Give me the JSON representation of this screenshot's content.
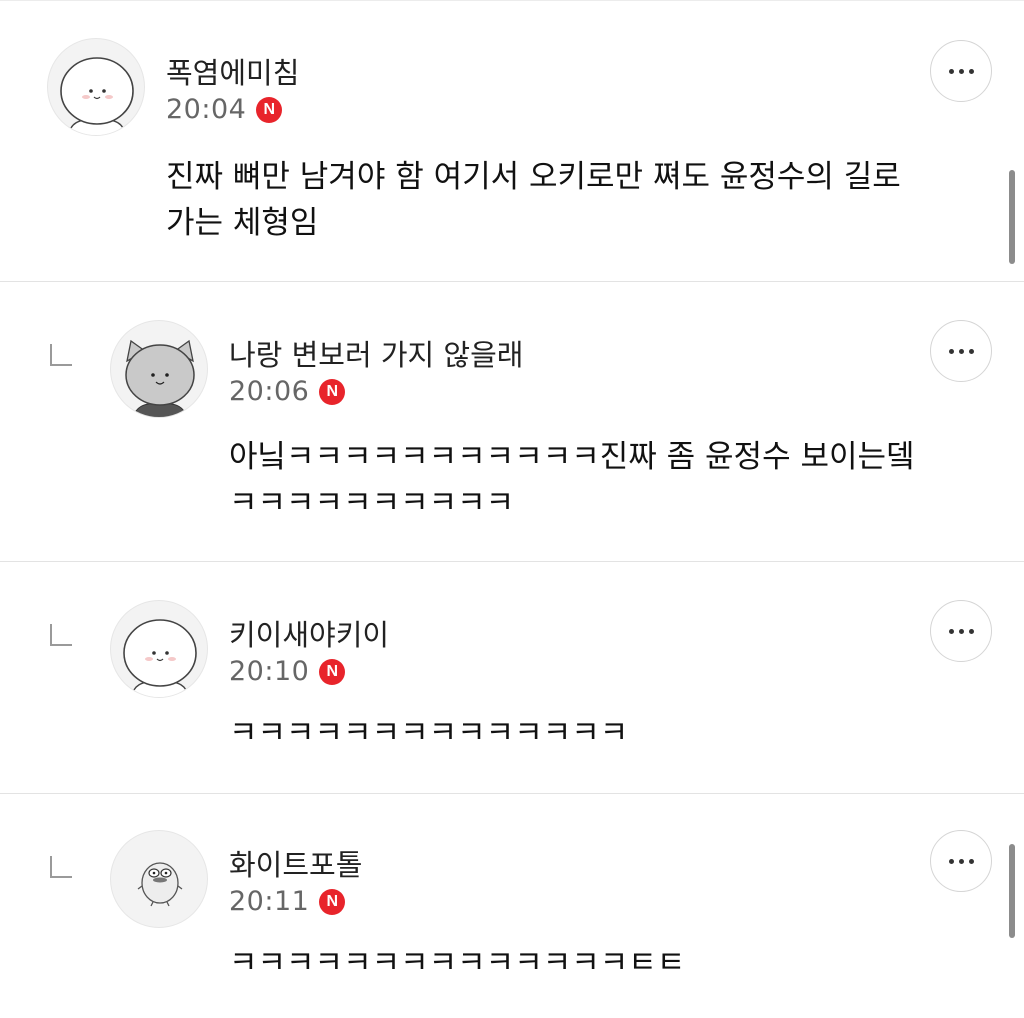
{
  "comments": [
    {
      "nickname": "폭염에미침",
      "time": "20:04",
      "badge": "N",
      "avatar_icon": "white-bear-face-icon",
      "lines": [
        "진짜 뼈만 남겨야 함 여기서 오키로만 쪄도 윤정수의 길로",
        "가는 체형임"
      ]
    },
    {
      "nickname": "나랑 변보러 가지 않을래",
      "time": "20:06",
      "badge": "N",
      "avatar_icon": "gray-cat-face-icon",
      "lines": [
        "아닠ㅋㅋㅋㅋㅋㅋㅋㅋㅋㅋㅋ진짜 좀 윤정수 보이는뎈",
        "ㅋㅋㅋㅋㅋㅋㅋㅋㅋㅋ"
      ]
    },
    {
      "nickname": "키이새야키이",
      "time": "20:10",
      "badge": "N",
      "avatar_icon": "white-bear-face-icon",
      "lines": [
        "ㅋㅋㅋㅋㅋㅋㅋㅋㅋㅋㅋㅋㅋㅋ"
      ]
    },
    {
      "nickname": "화이트포톨",
      "time": "20:11",
      "badge": "N",
      "avatar_icon": "yellow-duck-character-icon",
      "lines": [
        "ㅋㅋㅋㅋㅋㅋㅋㅋㅋㅋㅋㅋㅋㅋㅌㅌ"
      ]
    }
  ],
  "colors": {
    "badge": "#e8242b",
    "divider": "#e3e3e3",
    "time": "#666666"
  }
}
